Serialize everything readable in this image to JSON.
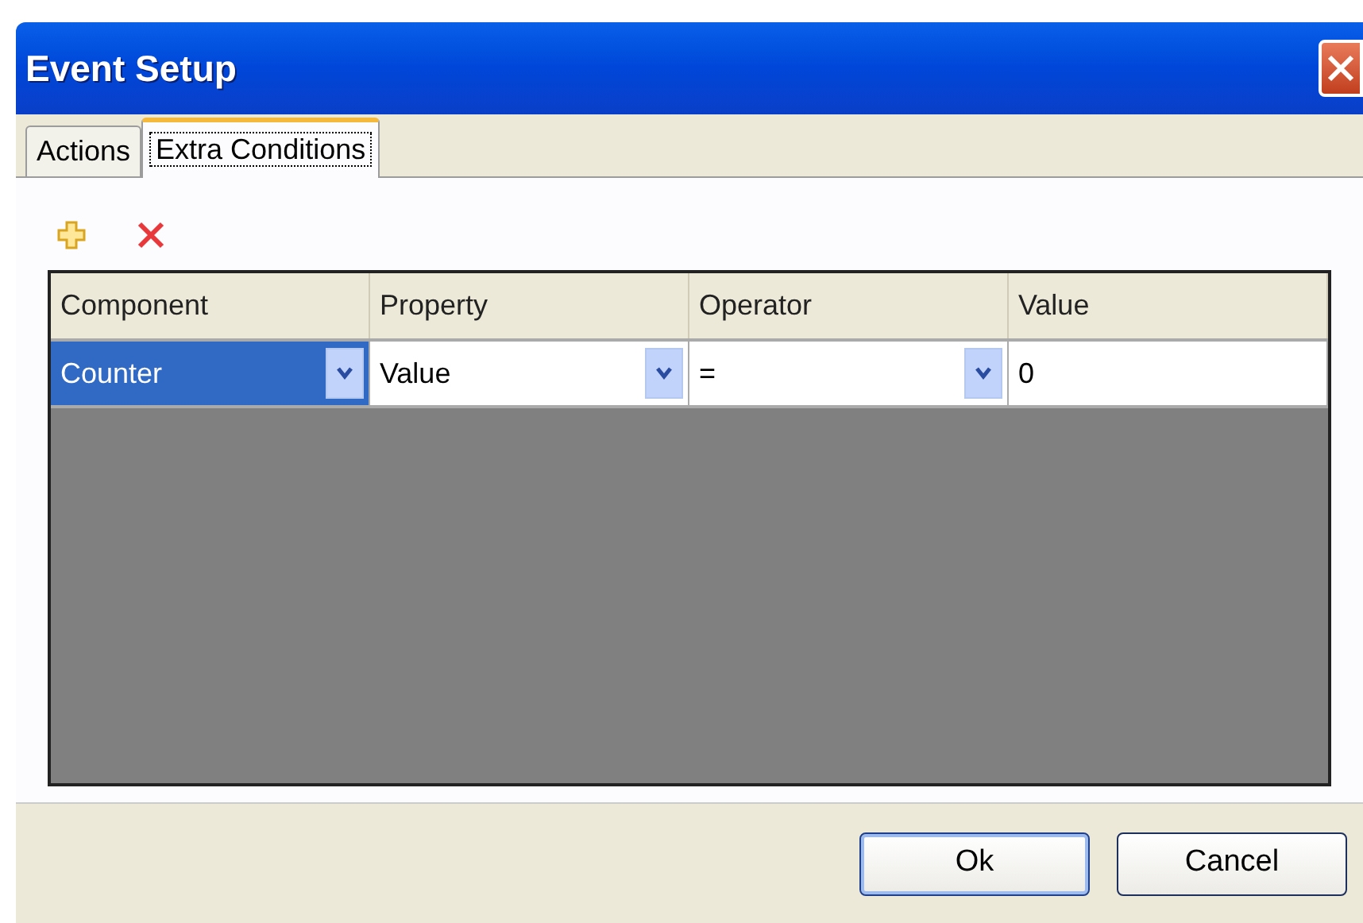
{
  "window": {
    "title": "Event Setup"
  },
  "tabs": [
    {
      "label": "Actions",
      "selected": false
    },
    {
      "label": "Extra Conditions",
      "selected": true
    }
  ],
  "table": {
    "columns": [
      "Component",
      "Property",
      "Operator",
      "Value"
    ],
    "rows": [
      {
        "cells": [
          {
            "kind": "combo",
            "value": "Counter",
            "selected": true
          },
          {
            "kind": "combo",
            "value": "Value",
            "selected": false
          },
          {
            "kind": "combo",
            "value": "=",
            "selected": false
          },
          {
            "kind": "text",
            "value": "0",
            "selected": false
          }
        ]
      }
    ]
  },
  "buttons": [
    {
      "label": "Ok",
      "default": true
    },
    {
      "label": "Cancel",
      "default": false
    }
  ]
}
